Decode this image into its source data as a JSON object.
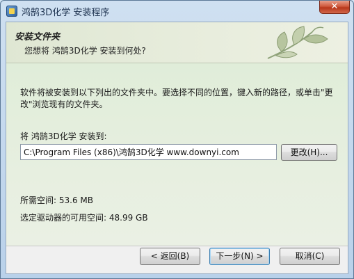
{
  "window": {
    "title": "鸿鹄3D化学 安装程序",
    "close_glyph": "✕",
    "icon": "installer-app-icon"
  },
  "header": {
    "title": "安装文件夹",
    "subtitle": "您想将 鸿鹄3D化学 安装到何处?",
    "decoration_icon": "leaf-icon"
  },
  "body": {
    "description": "软件将被安装到以下列出的文件夹中。要选择不同的位置，键入新的路径，或单击\"更改\"浏览现有的文件夹。",
    "install_label": "将 鸿鹄3D化学 安装到:",
    "install_path": "C:\\Program Files (x86)\\鸿鹄3D化学 www.downyi.com",
    "browse_label": "更改(H)...",
    "required_space": "所需空间: 53.6 MB",
    "available_space": "选定驱动器的可用空间: 48.99 GB"
  },
  "footer": {
    "back_label": "< 返回(B)",
    "next_label": "下一步(N) >",
    "cancel_label": "取消(C)"
  },
  "colors": {
    "header_bg": "#e8eddd",
    "body_bg": "#e4eedd",
    "frame": "#b9d1ea",
    "close_button": "#c9462a",
    "default_button_border": "#3c7fb1"
  }
}
